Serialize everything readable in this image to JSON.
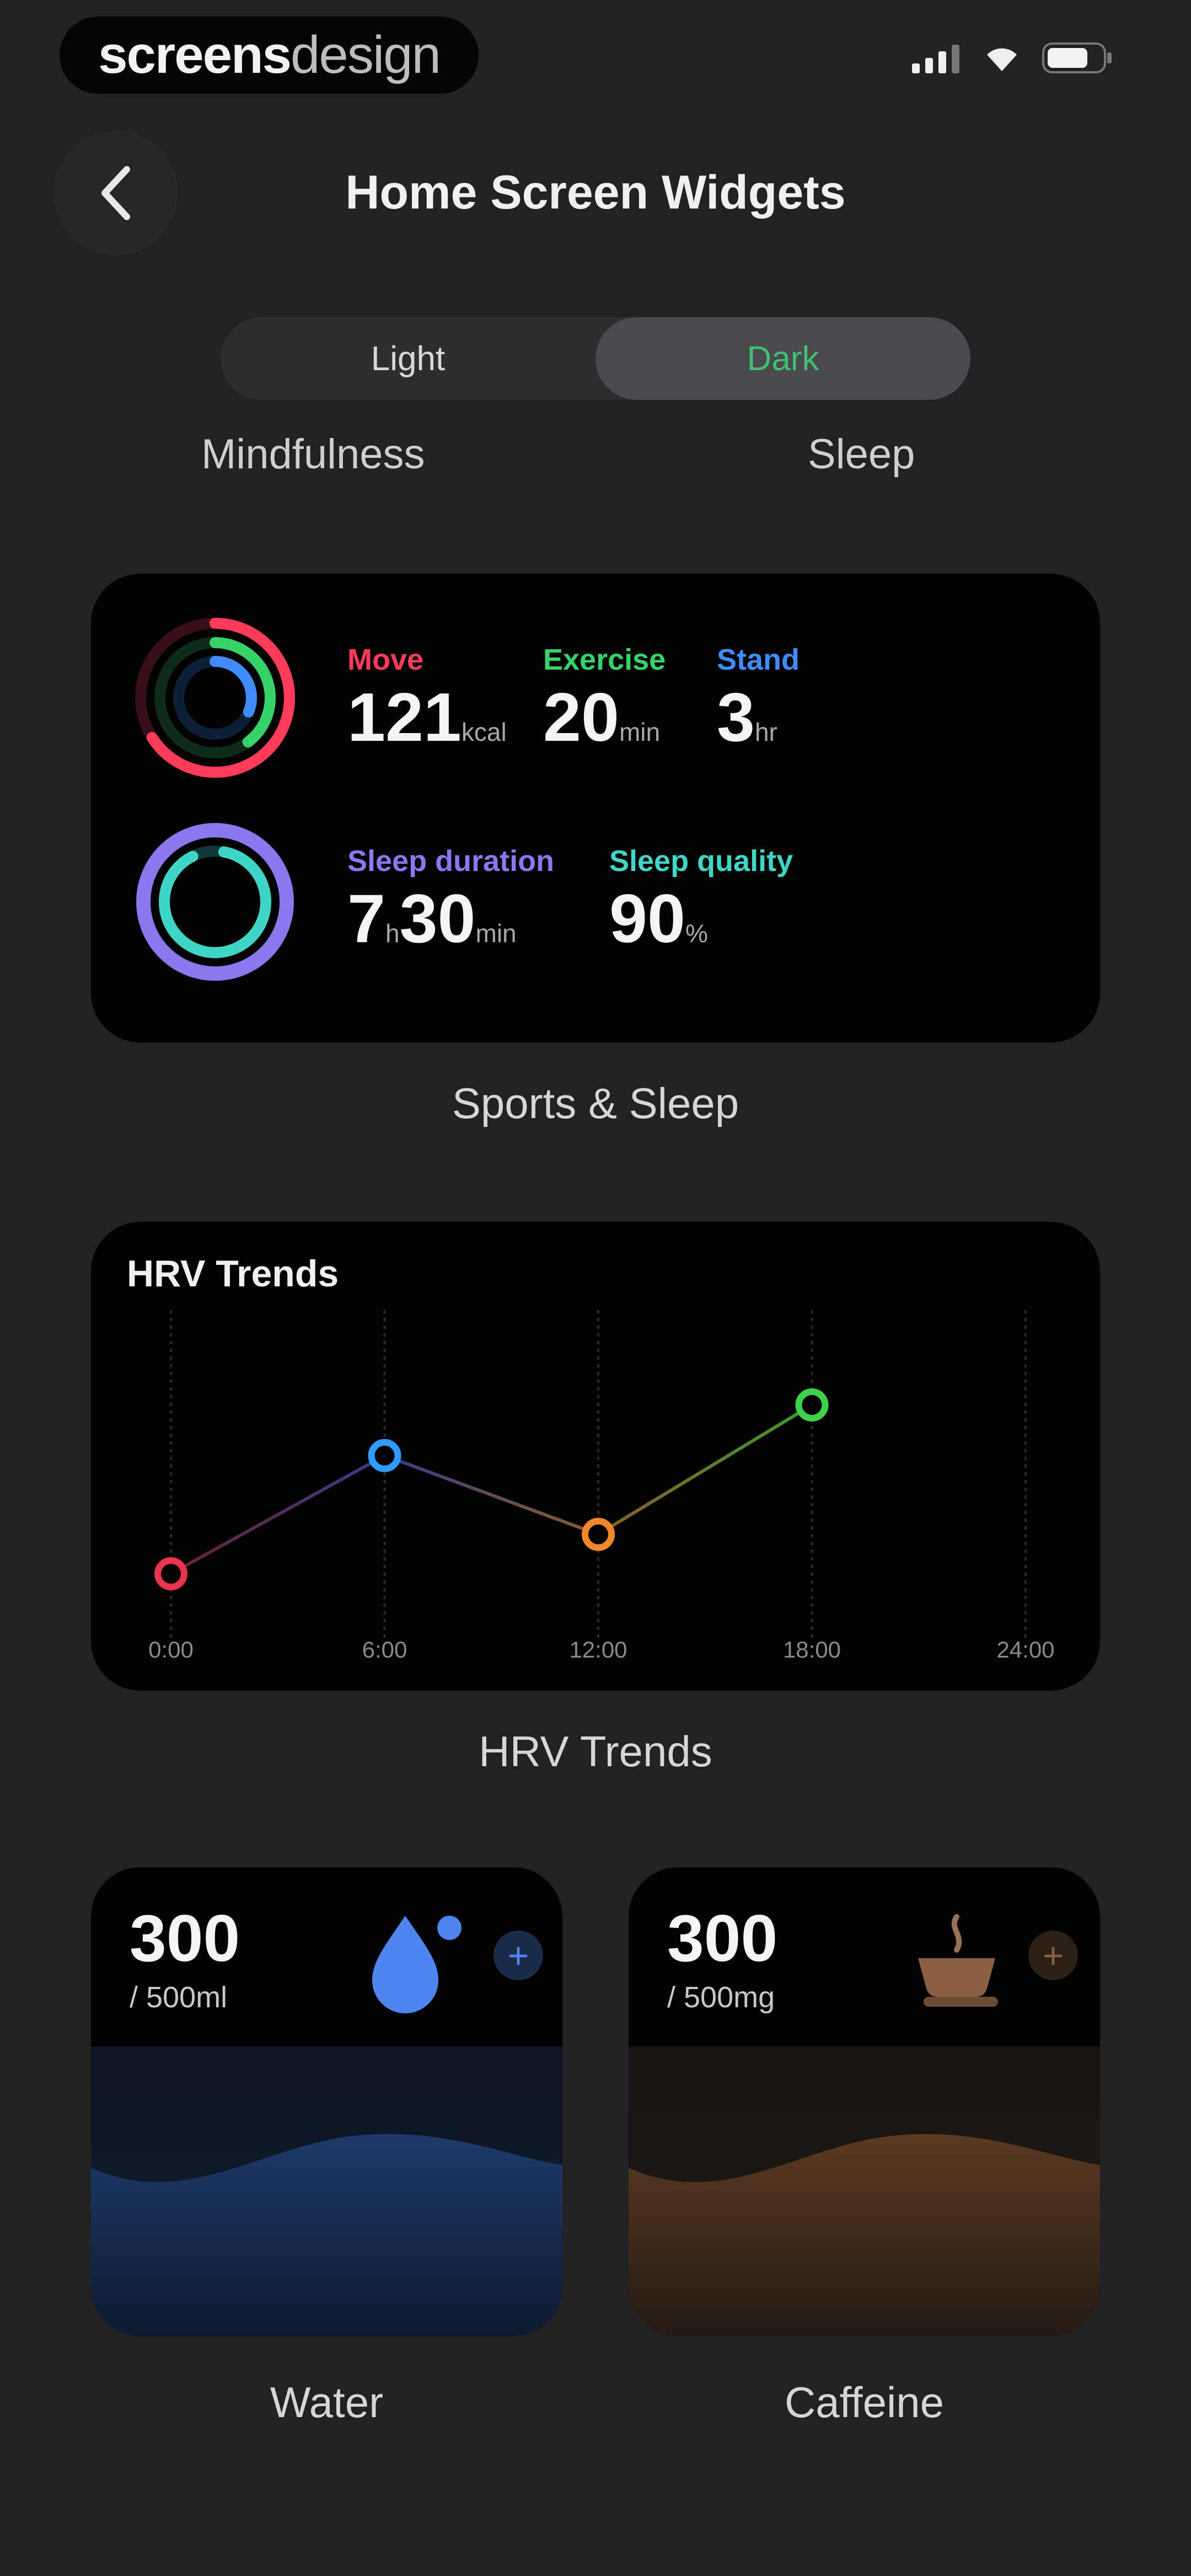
{
  "brand": {
    "part1": "screens",
    "part2": "design"
  },
  "header": {
    "title": "Home Screen Widgets"
  },
  "segmented": {
    "light": "Light",
    "dark": "Dark"
  },
  "tabs": {
    "mindfulness": "Mindfulness",
    "sleep": "Sleep"
  },
  "sports_sleep": {
    "move": {
      "label": "Move",
      "value": "121",
      "unit": "kcal"
    },
    "exercise": {
      "label": "Exercise",
      "value": "20",
      "unit": "min"
    },
    "stand": {
      "label": "Stand",
      "value": "3",
      "unit": "hr"
    },
    "sleep_duration": {
      "label": "Sleep duration",
      "hours": "7",
      "hours_unit": "h",
      "minutes": "30",
      "minutes_unit": "min"
    },
    "sleep_quality": {
      "label": "Sleep quality",
      "value": "90",
      "unit": "%"
    },
    "caption": "Sports & Sleep",
    "colors": {
      "move": "#ff3b5c",
      "exercise": "#35d36a",
      "stand": "#3f8cff",
      "sleep_duration": "#8a78f0",
      "sleep_quality": "#3fd6c8"
    }
  },
  "hrv": {
    "title": "HRV Trends",
    "caption": "HRV Trends",
    "ticks": [
      "0:00",
      "6:00",
      "12:00",
      "18:00",
      "24:00"
    ]
  },
  "chart_data": {
    "type": "line",
    "title": "HRV Trends",
    "x": [
      "0:00",
      "6:00",
      "12:00",
      "18:00"
    ],
    "x_ticks": [
      "0:00",
      "6:00",
      "12:00",
      "18:00",
      "24:00"
    ],
    "values": [
      20,
      62,
      34,
      80
    ],
    "point_colors": [
      "#e8344e",
      "#2f9bff",
      "#f0872a",
      "#3fd04c"
    ],
    "grid": true,
    "y_axis_labels": "none"
  },
  "water": {
    "value": "300",
    "goal": "/ 500ml",
    "caption": "Water",
    "color": "#4e86f0"
  },
  "caffeine": {
    "value": "300",
    "goal": "/ 500mg",
    "caption": "Caffeine",
    "color": "#8a6040"
  }
}
